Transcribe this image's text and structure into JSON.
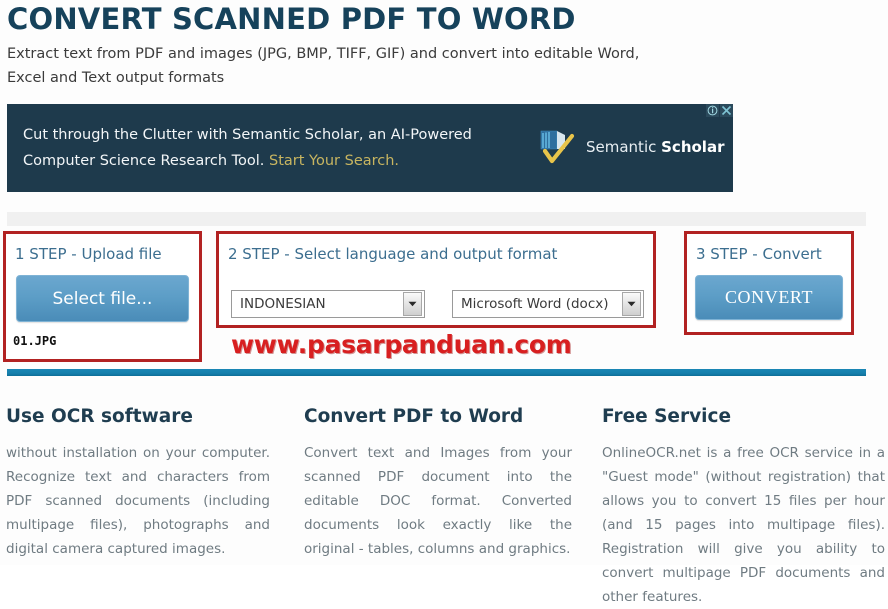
{
  "header": {
    "title": "CONVERT SCANNED PDF TO WORD",
    "subtitle": "Extract text from PDF and images (JPG, BMP, TIFF, GIF) and convert into editable Word, Excel and Text output formats"
  },
  "ad": {
    "copy_line1": "Cut through the Clutter with Semantic Scholar, an AI-Powered",
    "copy_line2": "Computer Science Research Tool. ",
    "cta": "Start Your Search.",
    "logo_text_light": "Semantic ",
    "logo_text_bold": "Scholar",
    "info_icon": "adchoices-info-icon",
    "close_icon": "close-icon",
    "background": "#1e3a4c",
    "cta_color": "#c8b560"
  },
  "steps": {
    "step1": {
      "title": "1 STEP - Upload file",
      "button_label": "Select file...",
      "file_name": "01.JPG"
    },
    "step2": {
      "title": "2 STEP - Select language and output format",
      "language_value": "INDONESIAN",
      "format_value": "Microsoft Word (docx)",
      "dropdown_icon": "chevron-down-icon"
    },
    "step3": {
      "title": "3 STEP - Convert",
      "button_label": "CONVERT"
    },
    "box_border_color": "#b22222",
    "title_color": "#3c6e8f"
  },
  "watermark": {
    "text": "www.pasarpanduan.com",
    "color": "#d81f20"
  },
  "divider": {
    "color": "#1680ad"
  },
  "info_columns": [
    {
      "heading": "Use OCR software",
      "body": "without installation on your computer. Recognize text and characters from PDF scanned documents (including multipage files), photographs and digital camera captured images."
    },
    {
      "heading": "Convert PDF to Word",
      "body": "Convert text and Images from your scanned PDF document into the editable DOC format. Converted documents look exactly like the original - tables, columns and graphics."
    },
    {
      "heading": "Free Service",
      "body": "OnlineOCR.net is a free OCR service in a \"Guest mode\" (without registration) that allows you to convert 15 files per hour (and 15 pages into multipage files). Registration will give you ability to convert multipage PDF documents and other features."
    }
  ]
}
